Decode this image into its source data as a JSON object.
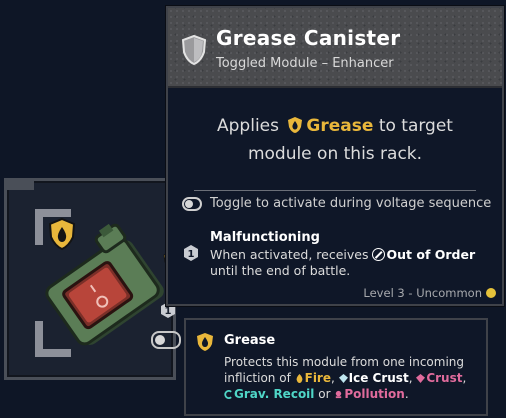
{
  "item": {
    "name": "Grease Canister",
    "type": "Toggled Module – Enhancer",
    "icon": "shield-icon",
    "description": {
      "prefix": "Applies",
      "keyword": "Grease",
      "keyword_icon": "grease-drop-icon",
      "suffix": "to target",
      "line2": "module on this rack."
    },
    "toggle_text": "Toggle to activate during voltage sequence",
    "malfunction": {
      "title": "Malfunctioning",
      "line1_prefix": "When activated, receives",
      "status": "Out of Order",
      "line2": "until the end of battle."
    },
    "footer": "Level 3 - Uncommon",
    "rarity_color": "#e6c23a"
  },
  "keyword_tip": {
    "title": "Grease",
    "text_prefix": "Protects this module from one incoming infliction of",
    "fire": "Fire",
    "ice_crust": "Ice Crust",
    "crust": "Crust",
    "grav_recoil": "Grav. Recoil",
    "or": "or",
    "pollution": "Pollution",
    "end": "."
  },
  "colors": {
    "gold": "#e9b73b",
    "pink": "#e06b9c",
    "teal": "#4fd6c7",
    "canister_green": "#5b7d56",
    "switch_red": "#b8453a"
  }
}
